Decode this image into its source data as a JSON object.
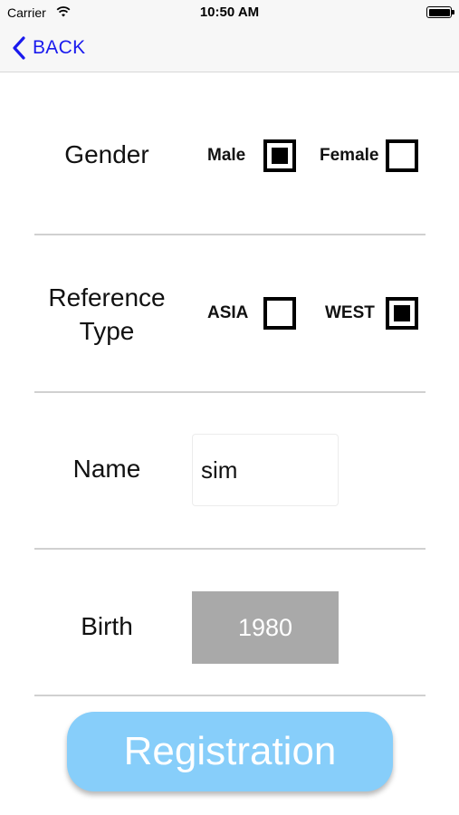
{
  "status_bar": {
    "carrier": "Carrier",
    "time": "10:50 AM",
    "icons": [
      "wifi-icon",
      "battery-icon"
    ]
  },
  "nav": {
    "back_label": "BACK",
    "back_icon": "chevron-left-icon",
    "accent_color": "#1a1aee"
  },
  "form": {
    "gender": {
      "label": "Gender",
      "options": [
        {
          "label": "Male",
          "checked": true
        },
        {
          "label": "Female",
          "checked": false
        }
      ]
    },
    "reference_type": {
      "label_line1": "Reference",
      "label_line2": "Type",
      "options": [
        {
          "label": "ASIA",
          "checked": false
        },
        {
          "label": "WEST",
          "checked": true
        }
      ]
    },
    "name": {
      "label": "Name",
      "value": "sim"
    },
    "birth": {
      "label": "Birth",
      "value": "1980",
      "field_color": "#a9a9a9"
    }
  },
  "registration_button": {
    "label": "Registration",
    "color": "#87cefa"
  }
}
